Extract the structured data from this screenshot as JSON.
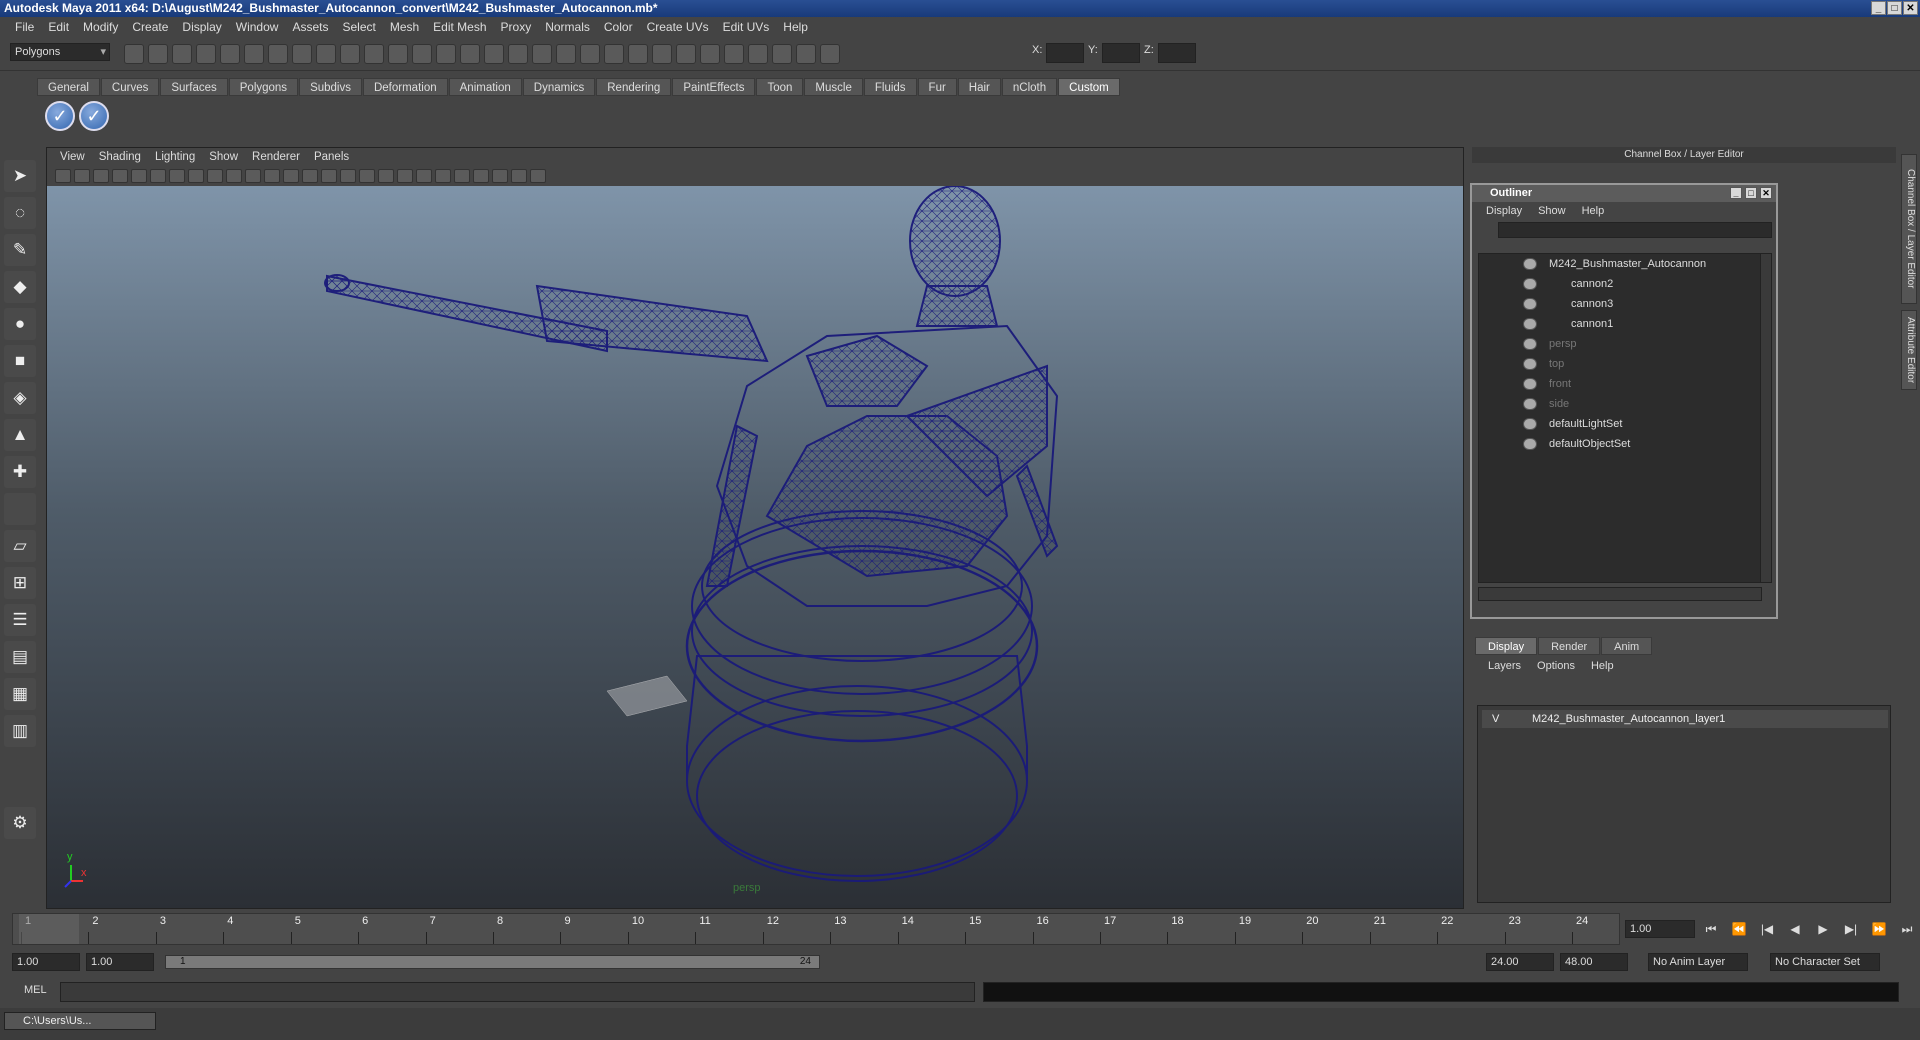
{
  "window": {
    "title": "Autodesk Maya 2011 x64: D:\\August\\M242_Bushmaster_Autocannon_convert\\M242_Bushmaster_Autocannon.mb*"
  },
  "menubar": [
    "File",
    "Edit",
    "Modify",
    "Create",
    "Display",
    "Window",
    "Assets",
    "Select",
    "Mesh",
    "Edit Mesh",
    "Proxy",
    "Normals",
    "Color",
    "Create UVs",
    "Edit UVs",
    "Help"
  ],
  "status": {
    "mode": "Polygons",
    "x_label": "X:",
    "y_label": "Y:",
    "z_label": "Z:"
  },
  "shelf": {
    "tabs": [
      "General",
      "Curves",
      "Surfaces",
      "Polygons",
      "Subdivs",
      "Deformation",
      "Animation",
      "Dynamics",
      "Rendering",
      "PaintEffects",
      "Toon",
      "Muscle",
      "Fluids",
      "Fur",
      "Hair",
      "nCloth",
      "Custom"
    ],
    "active_tab": "Custom",
    "buttons": [
      "check-icon",
      "check-icon"
    ]
  },
  "viewport": {
    "menu": [
      "View",
      "Shading",
      "Lighting",
      "Show",
      "Renderer",
      "Panels"
    ],
    "camera_label": "persp",
    "axis_y": "y",
    "axis_x": "x",
    "wire_color": "#1a1a7a"
  },
  "channel_box": {
    "title": "Channel Box / Layer Editor"
  },
  "outliner": {
    "title": "Outliner",
    "menu": [
      "Display",
      "Show",
      "Help"
    ],
    "items": [
      {
        "label": "M242_Bushmaster_Autocannon",
        "depth": 0,
        "dim": false
      },
      {
        "label": "cannon2",
        "depth": 1,
        "dim": false
      },
      {
        "label": "cannon3",
        "depth": 1,
        "dim": false
      },
      {
        "label": "cannon1",
        "depth": 1,
        "dim": false
      },
      {
        "label": "persp",
        "depth": 0,
        "dim": true
      },
      {
        "label": "top",
        "depth": 0,
        "dim": true
      },
      {
        "label": "front",
        "depth": 0,
        "dim": true
      },
      {
        "label": "side",
        "depth": 0,
        "dim": true
      },
      {
        "label": "defaultLightSet",
        "depth": 0,
        "dim": false
      },
      {
        "label": "defaultObjectSet",
        "depth": 0,
        "dim": false
      }
    ]
  },
  "layer_editor": {
    "tabs": [
      "Display",
      "Render",
      "Anim"
    ],
    "menu": [
      "Layers",
      "Options",
      "Help"
    ],
    "layer": {
      "visible": "V",
      "name": "M242_Bushmaster_Autocannon_layer1"
    }
  },
  "side_tabs": [
    "Channel Box / Layer Editor",
    "Attribute Editor"
  ],
  "timeline": {
    "frames": [
      "1",
      "2",
      "3",
      "4",
      "5",
      "6",
      "7",
      "8",
      "9",
      "10",
      "11",
      "12",
      "13",
      "14",
      "15",
      "16",
      "17",
      "18",
      "19",
      "20",
      "21",
      "22",
      "23",
      "24"
    ],
    "current_frame": "1.00",
    "playback": [
      "⏮",
      "⏪",
      "|◀",
      "◀",
      "▶",
      "▶|",
      "⏩",
      "⏭"
    ]
  },
  "range": {
    "start": "1.00",
    "anim_start": "1.00",
    "slider_start": "1",
    "slider_end": "24",
    "anim_end": "24.00",
    "end": "48.00",
    "anim_layer": "No Anim Layer",
    "char_set": "No Character Set"
  },
  "mel": {
    "label": "MEL"
  },
  "taskbar": {
    "item": "C:\\Users\\Us..."
  }
}
